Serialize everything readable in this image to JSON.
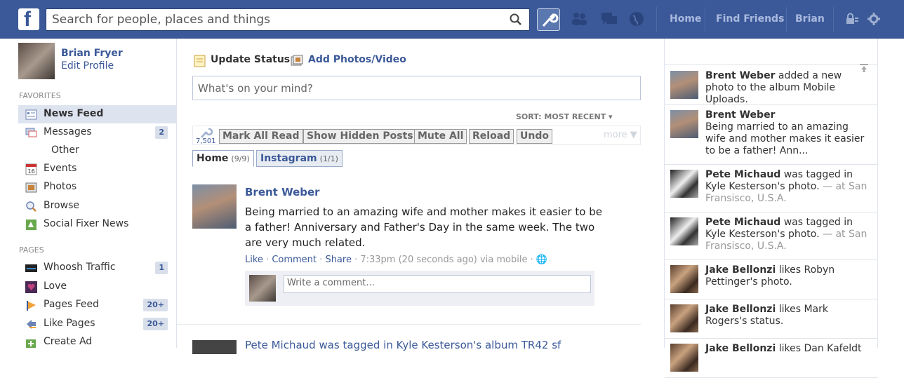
{
  "topbar": {
    "logo": "f",
    "search_placeholder": "Search for people, places and things",
    "links": [
      "Home",
      "Find Friends",
      "Brian"
    ]
  },
  "profile": {
    "name": "Brian Fryer",
    "edit": "Edit Profile"
  },
  "favorites": {
    "header": "FAVORITES",
    "items": [
      {
        "label": "News Feed",
        "icon": "news-feed-icon"
      },
      {
        "label": "Messages",
        "count": "2",
        "icon": "messages-icon"
      },
      {
        "label": "Other"
      },
      {
        "label": "Events",
        "icon": "events-icon",
        "icon_text": "16"
      },
      {
        "label": "Photos",
        "icon": "photos-icon"
      },
      {
        "label": "Browse",
        "icon": "browse-icon"
      },
      {
        "label": "Social Fixer News",
        "icon": "social-fixer-icon"
      }
    ]
  },
  "pages": {
    "header": "PAGES",
    "items": [
      {
        "label": "Whoosh Traffic",
        "count": "1",
        "icon": "whoosh-icon"
      },
      {
        "label": "Love",
        "icon": "love-icon"
      },
      {
        "label": "Pages Feed",
        "count": "20+",
        "icon": "pages-feed-icon"
      },
      {
        "label": "Like Pages",
        "count": "20+",
        "icon": "like-pages-icon"
      },
      {
        "label": "Create Ad",
        "icon": "create-ad-icon"
      }
    ]
  },
  "composer": {
    "update_status": "Update Status",
    "add_photos": "Add Photos/Video",
    "placeholder": "What's on your mind?"
  },
  "feed_controls": {
    "sort": "SORT: MOST RECENT ▾",
    "badge": "7,501",
    "buttons": [
      "Mark All Read",
      "Show Hidden Posts",
      "Mute All",
      "Reload",
      "Undo"
    ],
    "more": "more ▼",
    "tabs": [
      {
        "label": "Home",
        "count": "(9/9)"
      },
      {
        "label": "Instagram",
        "count": "(1/1)"
      }
    ]
  },
  "story": {
    "author": "Brent Weber",
    "text": "Being married to an amazing wife and mother makes it easier to be a father! Anniversary and Father's Day in the same week. The two are very much related.",
    "like": "Like",
    "comment": "Comment",
    "share": "Share",
    "time": "7:33pm (20 seconds ago) via mobile",
    "comment_placeholder": "Write a comment..."
  },
  "story2": {
    "text": "Pete Michaud was tagged in Kyle Kesterson's album TR42 sf"
  },
  "ticker": [
    {
      "name": "Brent Weber",
      "rest": "added a new photo to the album Mobile Uploads.",
      "pic": "couple"
    },
    {
      "name": "Brent Weber",
      "rest": "Being married to an amazing wife and mother makes it easier to be a father! Ann...",
      "pic": "couple",
      "newline": true
    },
    {
      "name": "Pete Michaud",
      "rest": "was tagged in Kyle Kesterson's photo.",
      "suffix": " — at San Fransisco, U.S.A.",
      "pic": "bw"
    },
    {
      "name": "Pete Michaud",
      "rest": "was tagged in Kyle Kesterson's photo.",
      "suffix": " — at San Fransisco, U.S.A.",
      "pic": "bw"
    },
    {
      "name": "Jake Bellonzi",
      "rest": "likes Robyn Pettinger's photo.",
      "pic": "group"
    },
    {
      "name": "Jake Bellonzi",
      "rest": "likes Mark Rogers's status.",
      "pic": "group"
    },
    {
      "name": "Jake Bellonzi",
      "rest": "likes Dan Kafeldt",
      "pic": "group"
    }
  ],
  "colors": {
    "brand": "#3b5998",
    "count_bg": "#d8dfea",
    "active_bg": "#dde3ef"
  }
}
